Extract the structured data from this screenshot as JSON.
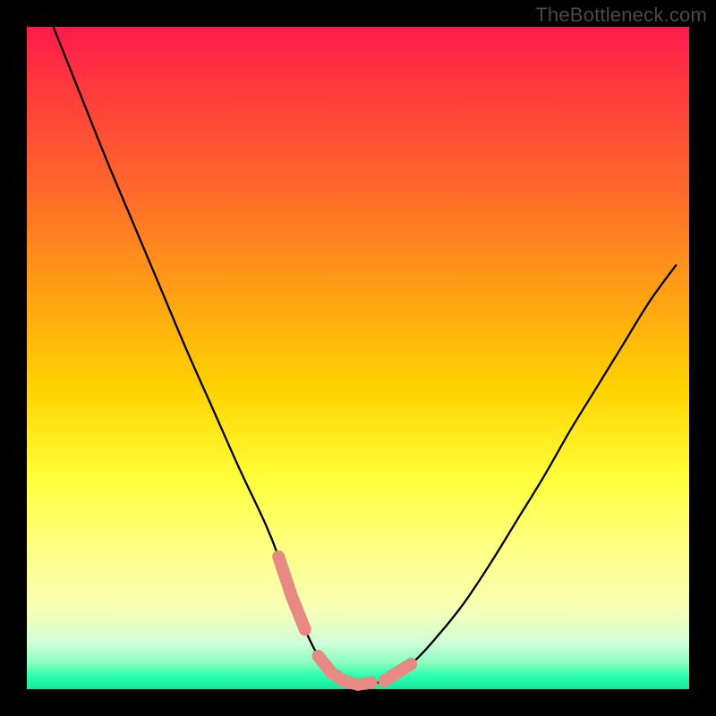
{
  "watermark": "TheBottleneck.com",
  "colors": {
    "frame": "#000000",
    "marker": "#e78a84",
    "curve": "#000000"
  },
  "chart_data": {
    "type": "line",
    "title": "",
    "xlabel": "",
    "ylabel": "",
    "xlim": [
      0,
      100
    ],
    "ylim": [
      0,
      100
    ],
    "grid": false,
    "legend": false,
    "series": [
      {
        "name": "bottleneck-curve",
        "x": [
          4,
          8,
          12,
          16,
          20,
          24,
          28,
          32,
          36,
          38,
          40,
          42,
          44,
          46,
          48,
          50,
          54,
          58,
          62,
          66,
          70,
          74,
          78,
          82,
          86,
          90,
          94,
          98
        ],
        "values": [
          100,
          90,
          80,
          70.5,
          61,
          51.5,
          42.5,
          33.5,
          25,
          20,
          14,
          9,
          5,
          2.5,
          1.2,
          0.7,
          1.3,
          3.8,
          8,
          13,
          19,
          25.5,
          32,
          39,
          45.5,
          52,
          58.5,
          64
        ]
      }
    ],
    "highlight_segments": [
      {
        "name": "left-descent-marker",
        "x_start": 38,
        "x_end": 42
      },
      {
        "name": "valley-floor-marker",
        "x_start": 44,
        "x_end": 52
      },
      {
        "name": "right-ascent-marker",
        "x_start": 54,
        "x_end": 58
      }
    ]
  }
}
